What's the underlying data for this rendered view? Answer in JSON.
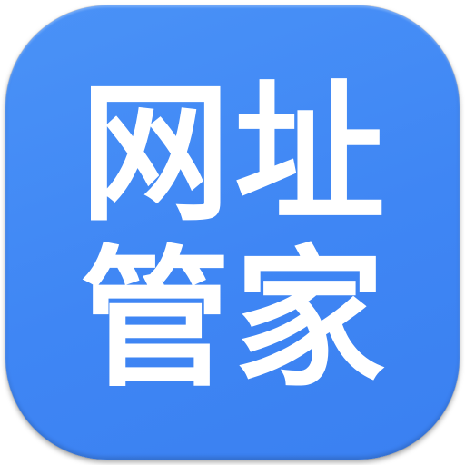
{
  "app_icon": {
    "characters": [
      "网",
      "址",
      "管",
      "家"
    ],
    "background_color": "#4289f5",
    "text_color": "#ffffff"
  }
}
